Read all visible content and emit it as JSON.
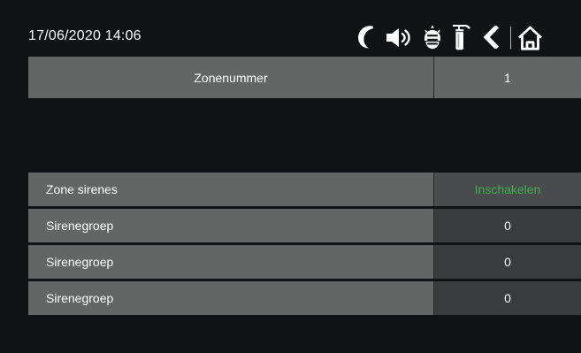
{
  "status_bar": {
    "datetime": "17/06/2020 14:06",
    "icons": [
      "moon-icon",
      "speaker-icon",
      "fire-alarm-icon",
      "extinguisher-icon",
      "back-icon",
      "home-icon"
    ]
  },
  "zone": {
    "label": "Zonenummer",
    "value": "1"
  },
  "settings": [
    {
      "label": "Zone sirenes",
      "value": "Inschakelen",
      "value_color": "#3fae4d"
    },
    {
      "label": "Sirenegroep",
      "value": "0"
    },
    {
      "label": "Sirenegroep",
      "value": "0"
    },
    {
      "label": "Sirenegroep",
      "value": "0"
    }
  ],
  "colors": {
    "background": "#111214",
    "label_cell": "#646565",
    "value_cell": "#3a3b3d",
    "active_value": "#3fae4d"
  }
}
